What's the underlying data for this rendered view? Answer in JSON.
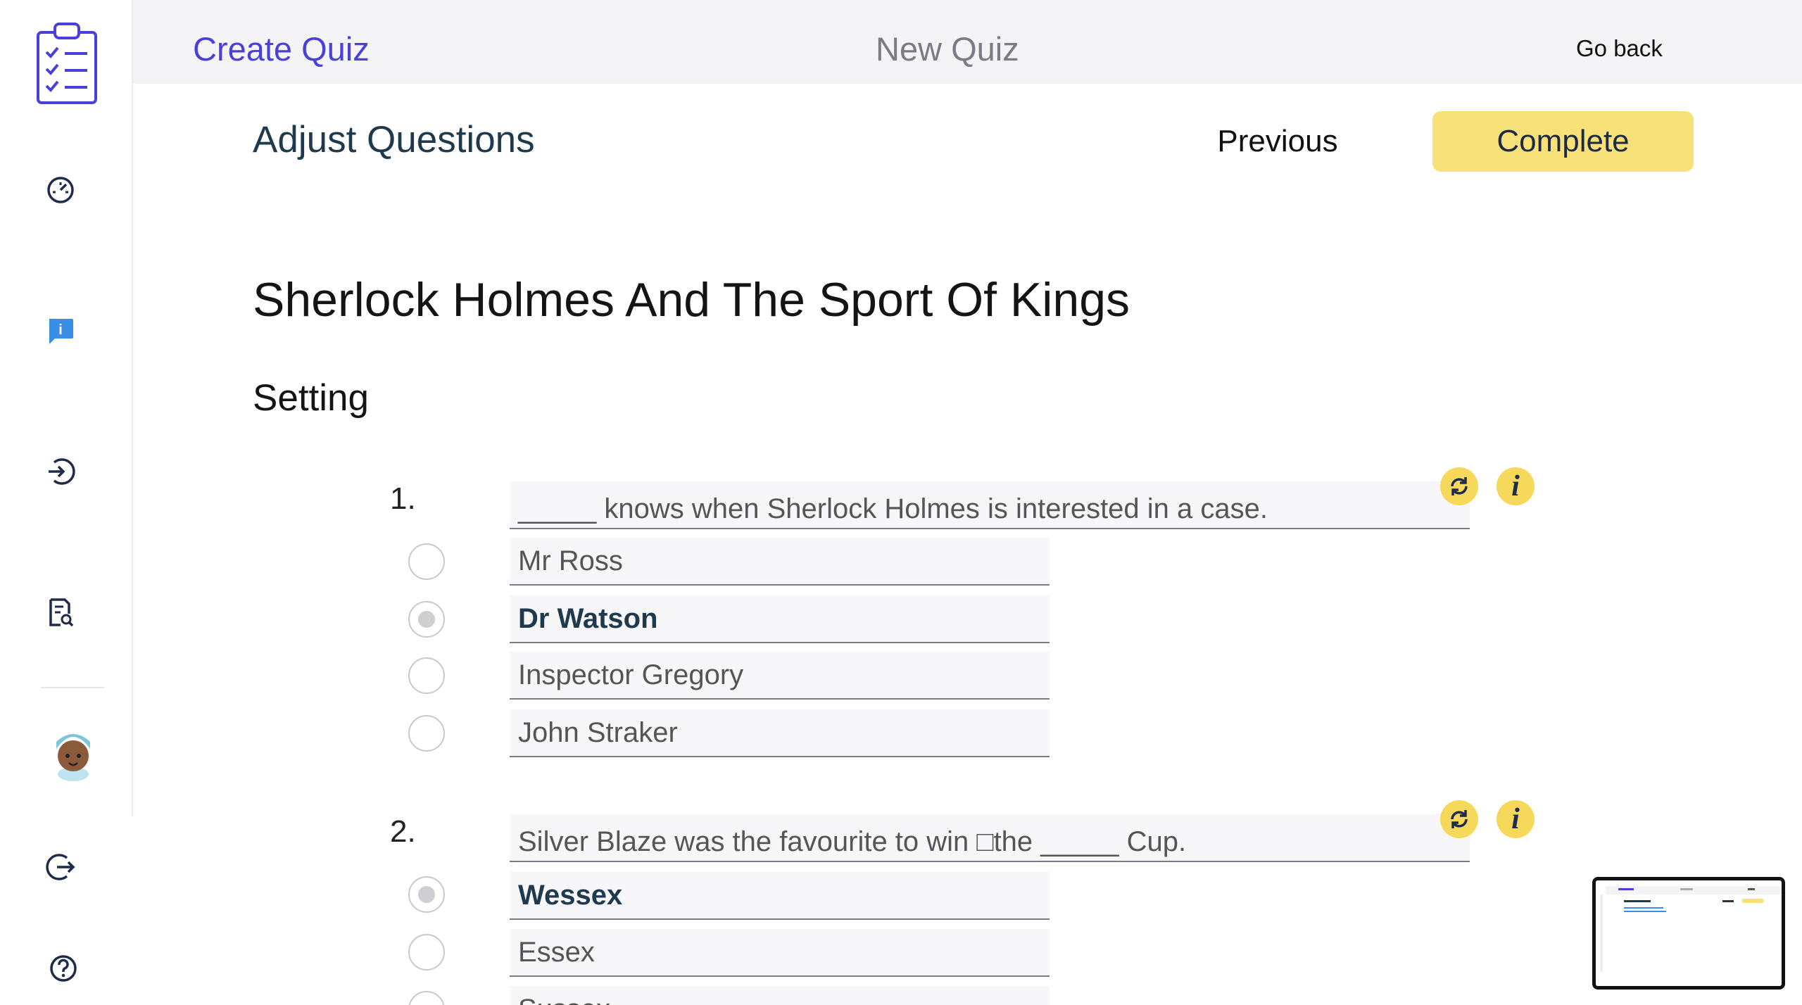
{
  "topbar": {
    "title": "Create Quiz",
    "center_title": "New Quiz",
    "back_label": "Go back"
  },
  "sidebar": {
    "items": [
      {
        "icon": "clipboard-checklist-icon"
      },
      {
        "icon": "speedometer-icon"
      },
      {
        "icon": "info-chat-icon"
      },
      {
        "icon": "login-icon"
      },
      {
        "icon": "document-search-icon"
      },
      {
        "icon": "avatar"
      },
      {
        "icon": "logout-icon"
      },
      {
        "icon": "help-icon"
      }
    ]
  },
  "header": {
    "heading": "Adjust Questions",
    "previous_label": "Previous",
    "complete_label": "Complete"
  },
  "quiz": {
    "title": "Sherlock Holmes And The Sport Of Kings",
    "section": "Setting",
    "questions": [
      {
        "number": "1.",
        "text": "_____ knows when Sherlock Holmes is interested in a case.",
        "answers": [
          "Mr Ross",
          "Dr Watson",
          "Inspector Gregory",
          "John Straker"
        ],
        "correct_index": 1
      },
      {
        "number": "2.",
        "text": "Silver Blaze was the favourite to win □the _____ Cup.",
        "answers": [
          "Wessex",
          "Essex",
          "Sussex"
        ],
        "correct_index": 0
      }
    ]
  },
  "colors": {
    "accent": "#4a40d8",
    "complete_button": "#f9e17a",
    "icon_button": "#f6d85a",
    "heading": "#1f3a4d"
  }
}
